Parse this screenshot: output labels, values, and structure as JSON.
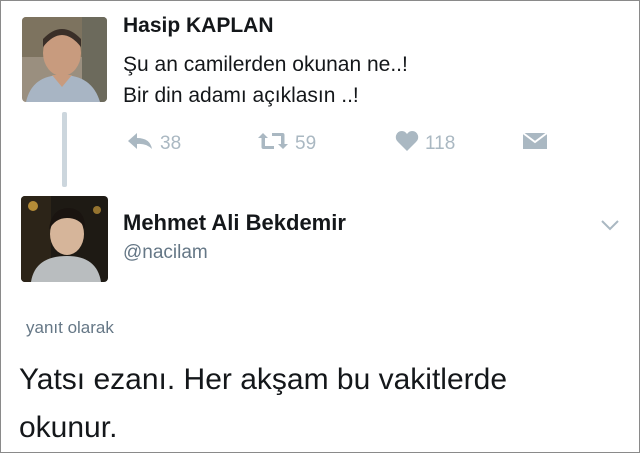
{
  "original_tweet": {
    "author_name": "Hasip KAPLAN",
    "text_lines": [
      "Şu an camilerden okunan ne..!",
      "Bir din adamı açıklasın ..!"
    ],
    "actions": {
      "reply_count": "38",
      "retweet_count": "59",
      "like_count": "118"
    },
    "icons": {
      "reply": "reply-icon",
      "retweet": "retweet-icon",
      "like": "heart-icon",
      "dm": "envelope-icon"
    }
  },
  "reply_tweet": {
    "author_name": "Mehmet Ali Bekdemir",
    "handle": "@nacilam",
    "context_label": "yanıt olarak",
    "text_lines": [
      "Yatsı ezanı. Her akşam bu vakitlerde",
      "okunur."
    ],
    "menu_icon": "chevron-down-icon"
  },
  "colors": {
    "text": "#14171a",
    "secondary": "#657786",
    "icon_gray": "#aab8c2",
    "thread_line": "#ccd6dd"
  }
}
